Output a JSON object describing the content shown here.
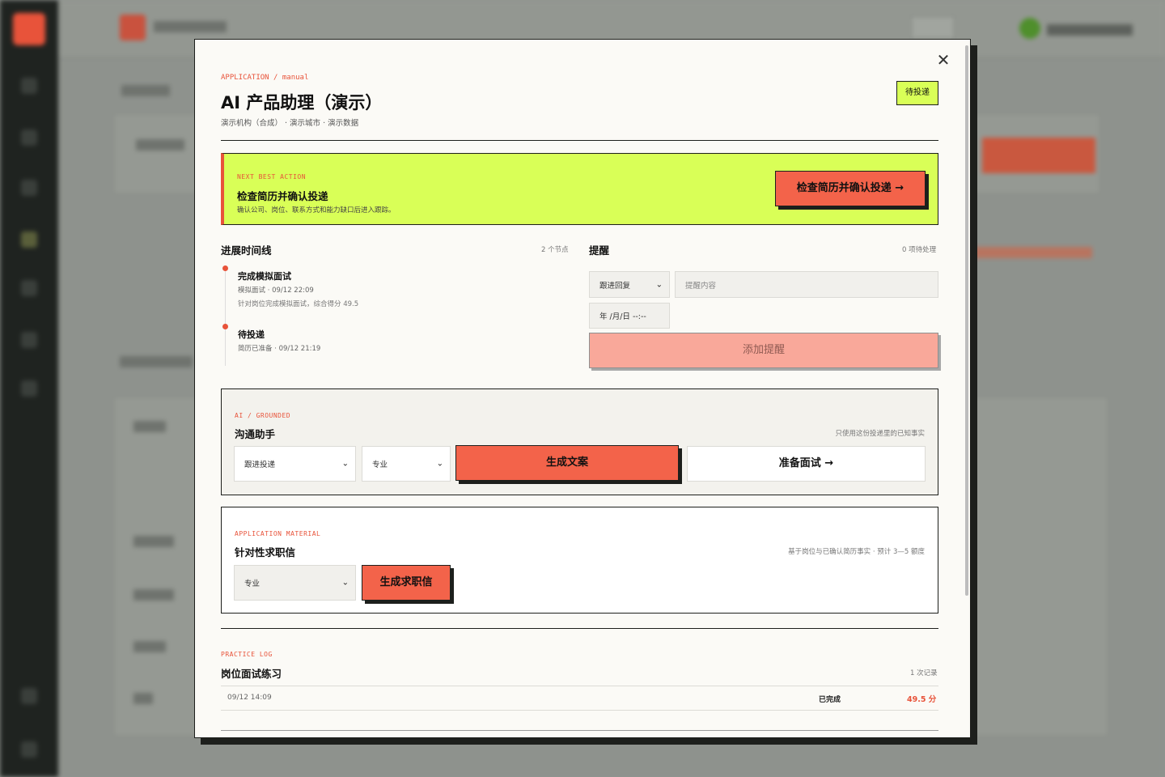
{
  "header": {
    "breadcrumb_left": "APPLICATION",
    "breadcrumb_sep": "/",
    "breadcrumb_right": "manual",
    "title": "AI 产品助理（演示）",
    "subtitle": "演示机构（合成） · 演示城市 · 演示数据",
    "status_badge": "待投递",
    "close_icon": "close-icon"
  },
  "next_action": {
    "kicker": "NEXT BEST ACTION",
    "title": "检查简历并确认投递",
    "description": "确认公司、岗位、联系方式和能力缺口后进入跟踪。",
    "button_label": "检查简历并确认投递 →",
    "highlight_color": "#d9ff57",
    "accent_color": "#e8533a"
  },
  "timeline": {
    "title": "进展时间线",
    "count_label": "2 个节点",
    "items": [
      {
        "title": "完成模拟面试",
        "meta": "模拟面试 · 09/12 22:09",
        "desc": "针对岗位完成模拟面试，综合得分 49.5"
      },
      {
        "title": "待投递",
        "meta": "简历已准备 · 09/12 21:19",
        "desc": ""
      }
    ]
  },
  "reminders": {
    "title": "提醒",
    "count_label": "0 项待处理",
    "type_select": "跟进回复",
    "content_placeholder": "提醒内容",
    "date_placeholder": "年 /月/日 --:--",
    "add_button": "添加提醒"
  },
  "comm_assistant": {
    "kicker": "AI / GROUNDED",
    "title": "沟通助手",
    "note": "只使用这份投递里的已知事实",
    "scenario_select": "跟进投递",
    "tone_select": "专业",
    "generate_button": "生成文案",
    "interview_button": "准备面试 →"
  },
  "cover_letter": {
    "kicker": "APPLICATION MATERIAL",
    "title": "针对性求职信",
    "note": "基于岗位与已确认简历事实 · 预计 3—5 额度",
    "tone_select": "专业",
    "generate_button": "生成求职信"
  },
  "practice_log": {
    "kicker": "PRACTICE LOG",
    "title": "岗位面试练习",
    "count_label": "1 次记录",
    "rows": [
      {
        "time": "09/12 14:09",
        "status": "已完成",
        "score": "49.5 分"
      }
    ]
  }
}
